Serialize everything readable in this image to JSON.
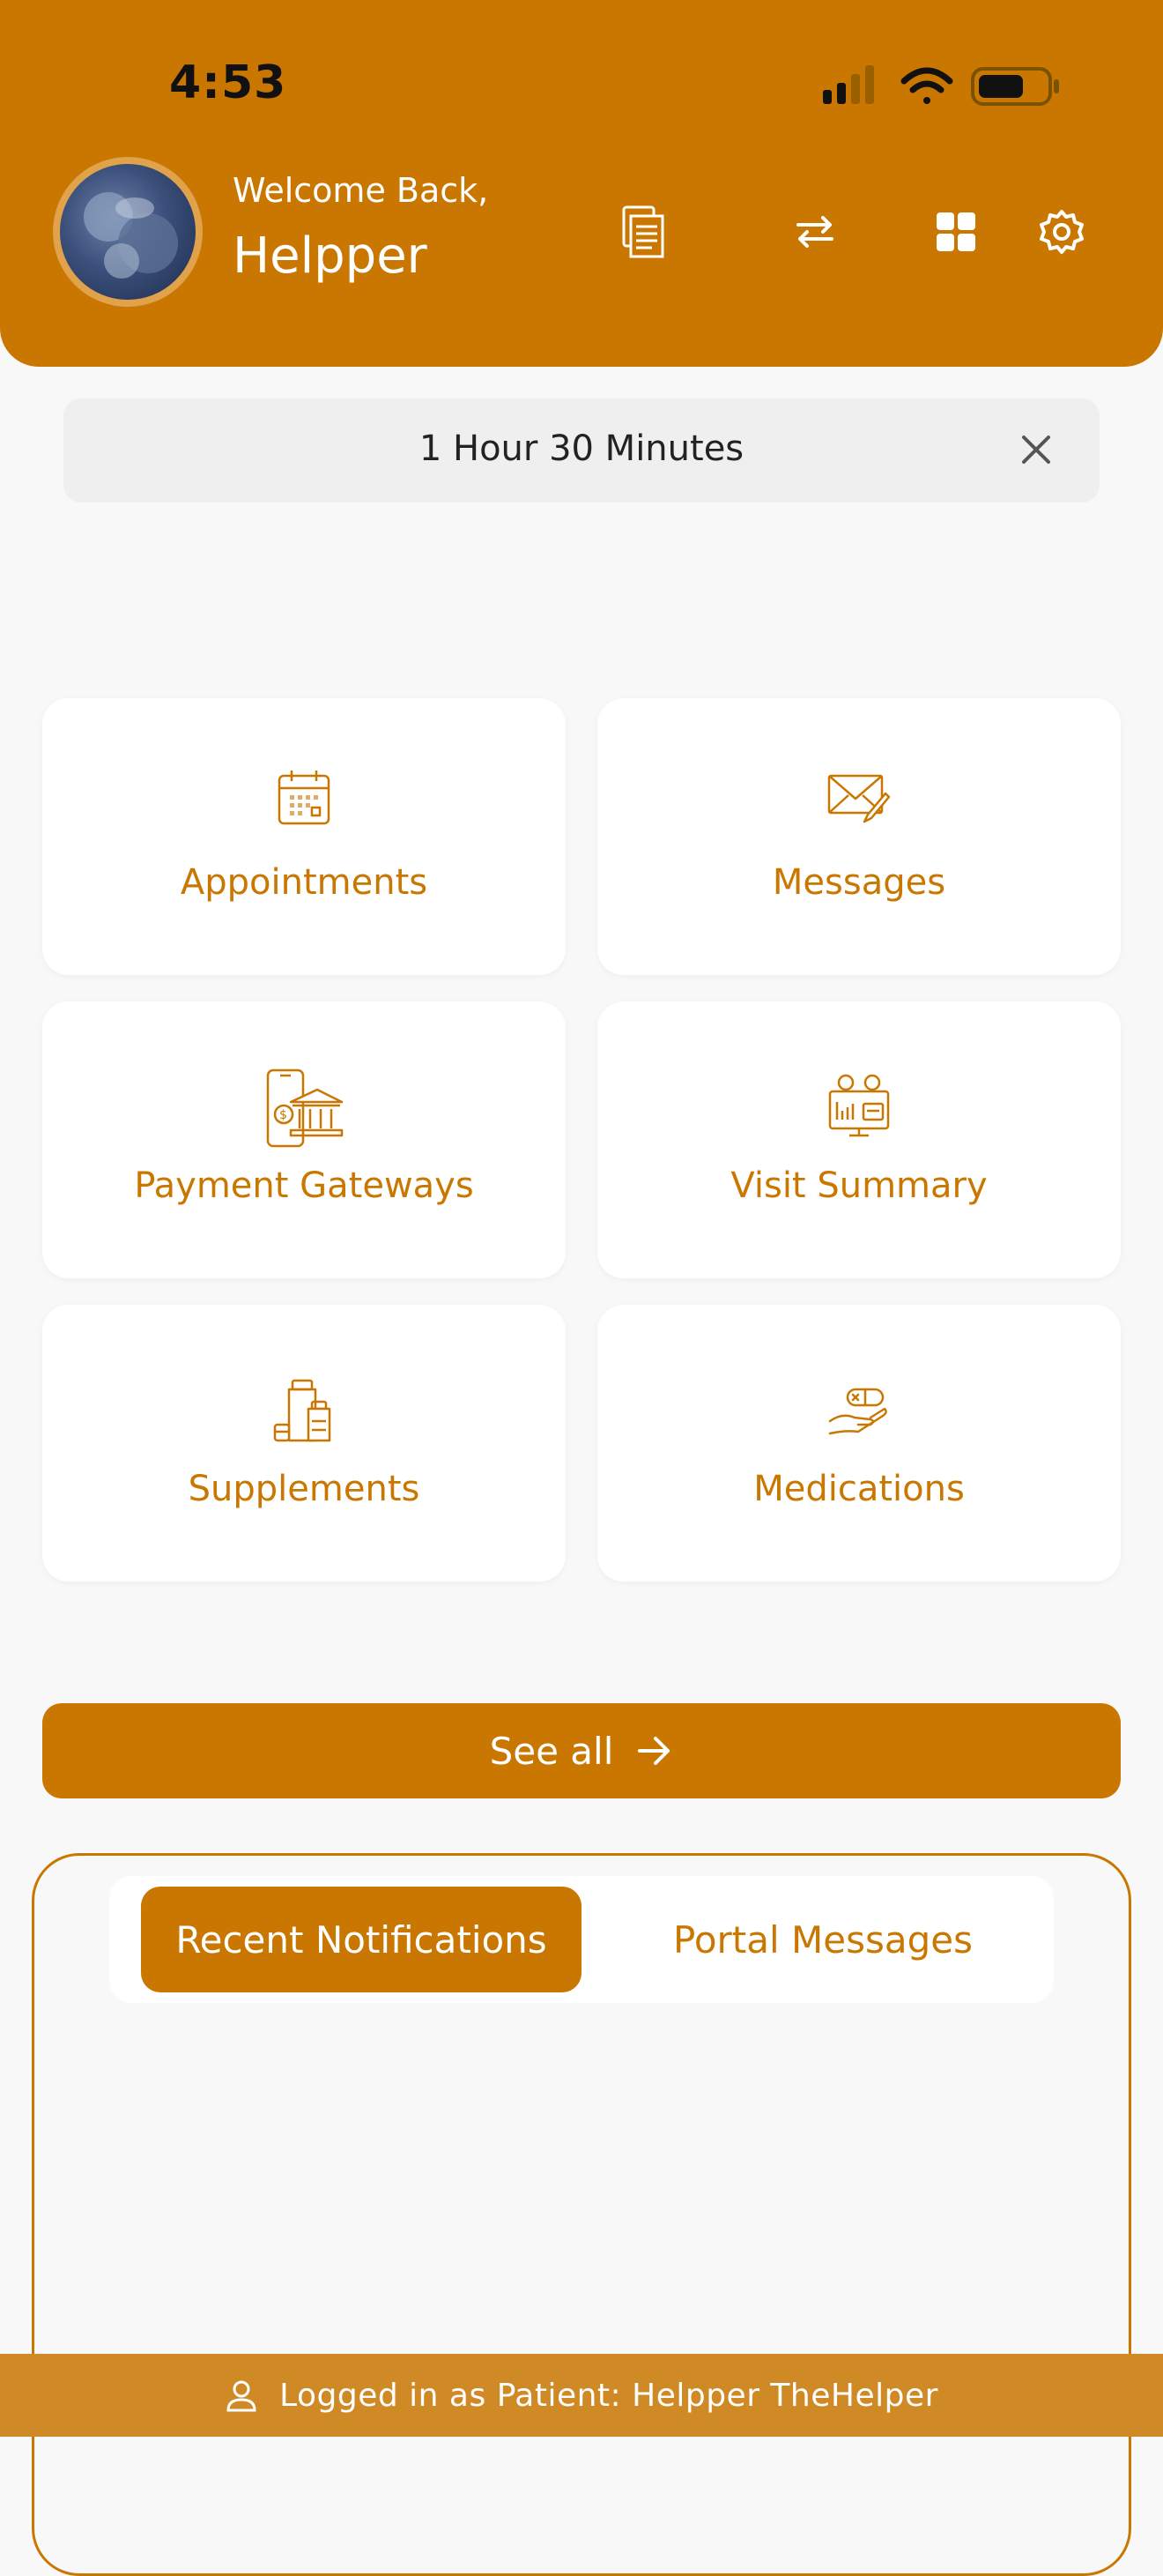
{
  "status_bar": {
    "time": "4:53"
  },
  "header": {
    "welcome": "Welcome Back,",
    "username": "Helpper",
    "icons": [
      "documents-icon",
      "swap-icon",
      "grid-icon",
      "gear-icon"
    ]
  },
  "timer": {
    "text": "1 Hour 30 Minutes"
  },
  "tiles": [
    {
      "label": "Appointments",
      "icon": "calendar-icon"
    },
    {
      "label": "Messages",
      "icon": "envelope-pen-icon"
    },
    {
      "label": "Payment Gateways",
      "icon": "bank-phone-icon"
    },
    {
      "label": "Visit Summary",
      "icon": "doctor-monitor-icon"
    },
    {
      "label": "Supplements",
      "icon": "bottles-icon"
    },
    {
      "label": "Medications",
      "icon": "pill-hand-icon"
    }
  ],
  "see_all": {
    "label": "See all"
  },
  "tabs": [
    {
      "label": "Recent Notifications",
      "active": true
    },
    {
      "label": "Portal Messages",
      "active": false
    }
  ],
  "login_bar": {
    "text": "Logged in as Patient: Helpper TheHelper"
  },
  "colors": {
    "accent": "#c97700",
    "login_bar": "#d08a25",
    "background": "#f8f8f8"
  }
}
